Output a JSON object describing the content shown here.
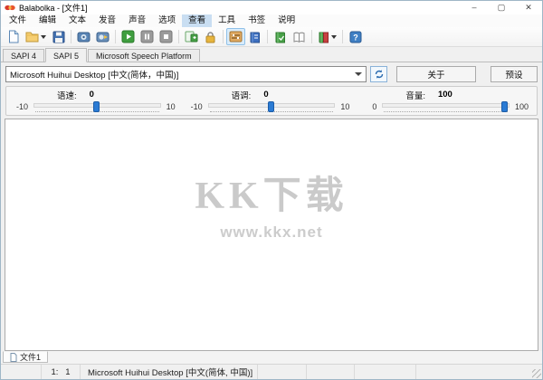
{
  "window": {
    "title": "Balabolka - [文件1]",
    "controls": {
      "minimize_glyph": "–",
      "maximize_glyph": "▢",
      "close_glyph": "✕"
    }
  },
  "menu": {
    "items": [
      {
        "label": "文件"
      },
      {
        "label": "编辑"
      },
      {
        "label": "文本"
      },
      {
        "label": "发音"
      },
      {
        "label": "声音"
      },
      {
        "label": "选项"
      },
      {
        "label": "查看",
        "active": true
      },
      {
        "label": "工具"
      },
      {
        "label": "书签"
      },
      {
        "label": "说明"
      }
    ]
  },
  "toolbar": {
    "help_glyph": "?",
    "icons": [
      {
        "name": "new-file-icon"
      },
      {
        "name": "open-file-icon"
      },
      {
        "name": "save-file-icon"
      },
      {
        "name": "save-audio-icon"
      },
      {
        "name": "convert-audio-icon"
      },
      {
        "name": "play-icon"
      },
      {
        "name": "pause-icon"
      },
      {
        "name": "stop-icon"
      },
      {
        "name": "speak-clipboard-icon"
      },
      {
        "name": "lock-icon"
      },
      {
        "name": "voice-panel-icon",
        "active": true
      },
      {
        "name": "dictionary-icon"
      },
      {
        "name": "spellcheck-book-icon"
      },
      {
        "name": "open-book-icon"
      },
      {
        "name": "translation-book-icon"
      },
      {
        "name": "help-icon"
      }
    ]
  },
  "voice_tabs": {
    "items": [
      {
        "label": "SAPI 4"
      },
      {
        "label": "SAPI 5",
        "active": true
      },
      {
        "label": "Microsoft Speech Platform"
      }
    ]
  },
  "voice_row": {
    "selected_voice": "Microsoft Huihui Desktop [中文(简体，中国)]",
    "about_label": "关于",
    "presets_label": "预设"
  },
  "sliders": {
    "rate": {
      "label": "语速:",
      "value": "0",
      "min": "-10",
      "max": "10"
    },
    "pitch": {
      "label": "语调:",
      "value": "0",
      "min": "-10",
      "max": "10"
    },
    "volume": {
      "label": "音量:",
      "value": "100",
      "min": "0",
      "max": "100"
    }
  },
  "editor": {
    "watermark_title": "KK下载",
    "watermark_url": "www.kkx.net"
  },
  "doc_tabs": {
    "items": [
      {
        "label": "文件1"
      }
    ]
  },
  "status_bar": {
    "line_col": "1:   1",
    "voice": "Microsoft Huihui Desktop [中文(简体, 中国)]"
  }
}
